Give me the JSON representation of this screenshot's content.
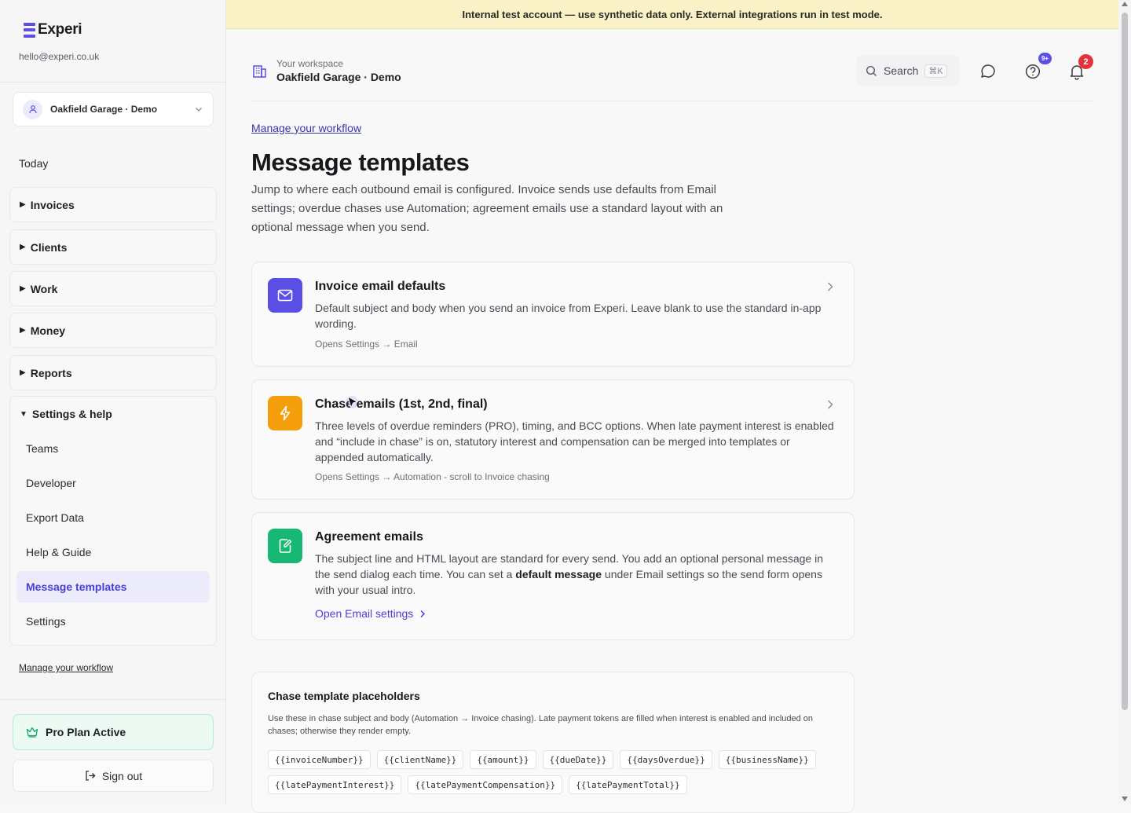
{
  "sidebar": {
    "brand": "Experi",
    "email": "hello@experi.co.uk",
    "workspace_select": "Oakfield Garage · Demo",
    "today": "Today",
    "groups": [
      {
        "label": "Invoices"
      },
      {
        "label": "Clients"
      },
      {
        "label": "Work"
      },
      {
        "label": "Money"
      },
      {
        "label": "Reports"
      }
    ],
    "open_group": {
      "label": "Settings & help",
      "items": [
        {
          "label": "Teams"
        },
        {
          "label": "Developer"
        },
        {
          "label": "Export Data"
        },
        {
          "label": "Help & Guide"
        },
        {
          "label": "Message templates",
          "active": true
        },
        {
          "label": "Settings"
        }
      ]
    },
    "manage_link": "Manage your workflow",
    "pro_plan": "Pro Plan Active",
    "sign_out": "Sign out"
  },
  "banner": "Internal test account — use synthetic data only. External integrations run in test mode.",
  "header": {
    "workspace_label": "Your workspace",
    "workspace_name": "Oakfield Garage · Demo",
    "search_label": "Search",
    "search_shortcut": "⌘K",
    "help_badge": "9+",
    "notification_badge": "2"
  },
  "main": {
    "breadcrumb_link": "Manage your workflow",
    "title": "Message templates",
    "description": "Jump to where each outbound email is configured. Invoice sends use defaults from Email settings; overdue chases use Automation; agreement emails use a standard layout with an optional message when you send.",
    "cards": [
      {
        "title": "Invoice email defaults",
        "body": "Default subject and body when you send an invoice from Experi. Leave blank to use the standard in-app wording.",
        "meta": "Opens Settings → Email",
        "icon": "mail-icon",
        "color": "#5b4ee6"
      },
      {
        "title": "Chase emails (1st, 2nd, final)",
        "body": "Three levels of overdue reminders (PRO), timing, and BCC options. When late payment interest is enabled and “include in chase” is on, statutory interest and compensation can be merged into templates or appended automatically.",
        "meta": "Opens Settings → Automation - scroll to Invoice chasing",
        "icon": "lightning-icon",
        "color": "#f59e0b"
      },
      {
        "title": "Agreement emails",
        "body_part1": "The subject line and HTML layout are standard for every send. You add an optional personal message in the send dialog each time. You can set a ",
        "body_bold": "default message",
        "body_part2": " under Email settings so the send form opens with your usual intro.",
        "link": "Open Email settings",
        "icon": "edit-document-icon",
        "color": "#16b873"
      }
    ],
    "placeholders": {
      "title": "Chase template placeholders",
      "description": "Use these in chase subject and body (Automation → Invoice chasing). Late payment tokens are filled when interest is enabled and included on chases; otherwise they render empty.",
      "tokens": [
        "{{invoiceNumber}}",
        "{{clientName}}",
        "{{amount}}",
        "{{dueDate}}",
        "{{daysOverdue}}",
        "{{businessName}}",
        "{{latePaymentInterest}}",
        "{{latePaymentCompensation}}",
        "{{latePaymentTotal}}"
      ]
    }
  }
}
